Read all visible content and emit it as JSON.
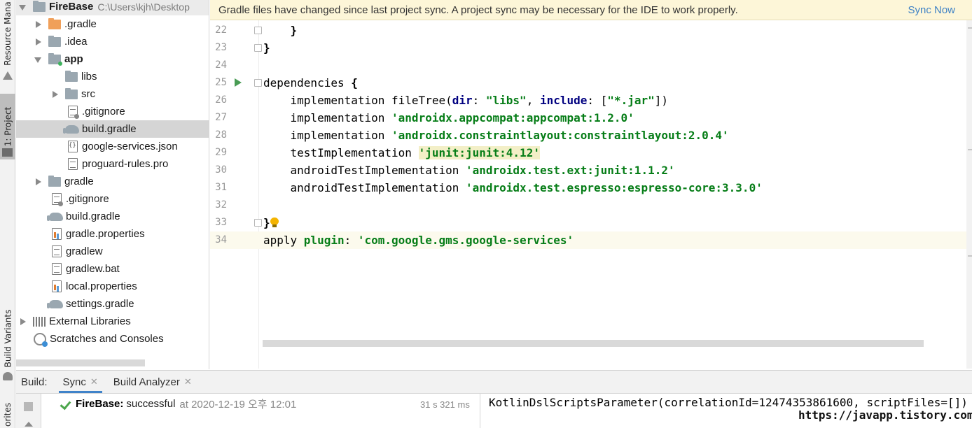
{
  "left_strip": {
    "resource_manager": "Resource Mana",
    "project": "1: Project",
    "build_variants": "Build Variants",
    "favorites": "orites"
  },
  "project_tree": {
    "root_name": "FireBase",
    "root_path": "C:\\Users\\kjh\\Desktop",
    "items": [
      {
        "label": ".gradle",
        "icon": "folder-orange-icon"
      },
      {
        "label": ".idea",
        "icon": "folder-icon"
      },
      {
        "label": "app",
        "icon": "module-folder-icon"
      },
      {
        "label": "libs",
        "icon": "folder-icon"
      },
      {
        "label": "src",
        "icon": "folder-icon"
      },
      {
        "label": ".gitignore",
        "icon": "gitignore-file-icon"
      },
      {
        "label": "build.gradle",
        "icon": "gradle-elephant-icon"
      },
      {
        "label": "google-services.json",
        "icon": "json-file-icon"
      },
      {
        "label": "proguard-rules.pro",
        "icon": "text-file-icon"
      },
      {
        "label": "gradle",
        "icon": "folder-icon"
      },
      {
        "label": ".gitignore",
        "icon": "gitignore-file-icon"
      },
      {
        "label": "build.gradle",
        "icon": "gradle-elephant-icon"
      },
      {
        "label": "gradle.properties",
        "icon": "properties-file-icon"
      },
      {
        "label": "gradlew",
        "icon": "text-file-icon"
      },
      {
        "label": "gradlew.bat",
        "icon": "text-file-icon"
      },
      {
        "label": "local.properties",
        "icon": "properties-file-icon"
      },
      {
        "label": "settings.gradle",
        "icon": "gradle-elephant-icon"
      },
      {
        "label": "External Libraries",
        "icon": "libraries-icon"
      },
      {
        "label": "Scratches and Consoles",
        "icon": "scratches-icon"
      }
    ]
  },
  "banner": {
    "message": "Gradle files have changed since last project sync. A project sync may be necessary for the IDE to work properly.",
    "action": "Sync Now"
  },
  "editor": {
    "line_numbers": [
      "22",
      "23",
      "24",
      "25",
      "26",
      "27",
      "28",
      "29",
      "30",
      "31",
      "32",
      "33",
      "34"
    ],
    "code": {
      "l22_brace": "}",
      "l23_brace": "}",
      "l25_kw": "dependencies",
      "l25_brace": "{",
      "l26_a": "implementation fileTree(",
      "l26_dir": "dir",
      "l26_b": ": ",
      "l26_libs": "\"libs\"",
      "l26_c": ", ",
      "l26_include": "include",
      "l26_d": ": [",
      "l26_jar": "\"*.jar\"",
      "l26_e": "])",
      "l27_a": "implementation ",
      "l27_str": "'androidx.appcompat:appcompat:1.2.0'",
      "l28_a": "implementation ",
      "l28_str": "'androidx.constraintlayout:constraintlayout:2.0.4'",
      "l29_a": "testImplementation ",
      "l29_str": "'junit:junit:4.12'",
      "l30_a": "androidTestImplementation ",
      "l30_str": "'androidx.test.ext:junit:1.1.2'",
      "l31_a": "androidTestImplementation ",
      "l31_str": "'androidx.test.espresso:espresso-core:3.3.0'",
      "l33_brace": "}",
      "l34_a": "apply ",
      "l34_kw": "plugin",
      "l34_b": ": ",
      "l34_str": "'com.google.gms.google-services'"
    }
  },
  "build_panel": {
    "label": "Build:",
    "tabs": [
      "Sync",
      "Build Analyzer"
    ],
    "result_name": "FireBase:",
    "result_status": "successful",
    "result_time": "at 2020-12-19 오후 12:01",
    "duration": "31 s 321 ms",
    "output": "KotlinDslScriptsParameter(correlationId=12474353861600, scriptFiles=[])"
  },
  "watermark": "https://javapp.tistory.com/",
  "colors": {
    "banner_bg": "#fdf6d8",
    "link": "#3f82c5",
    "string": "#067d17",
    "keyword": "#000080",
    "success": "#4ca64c"
  }
}
